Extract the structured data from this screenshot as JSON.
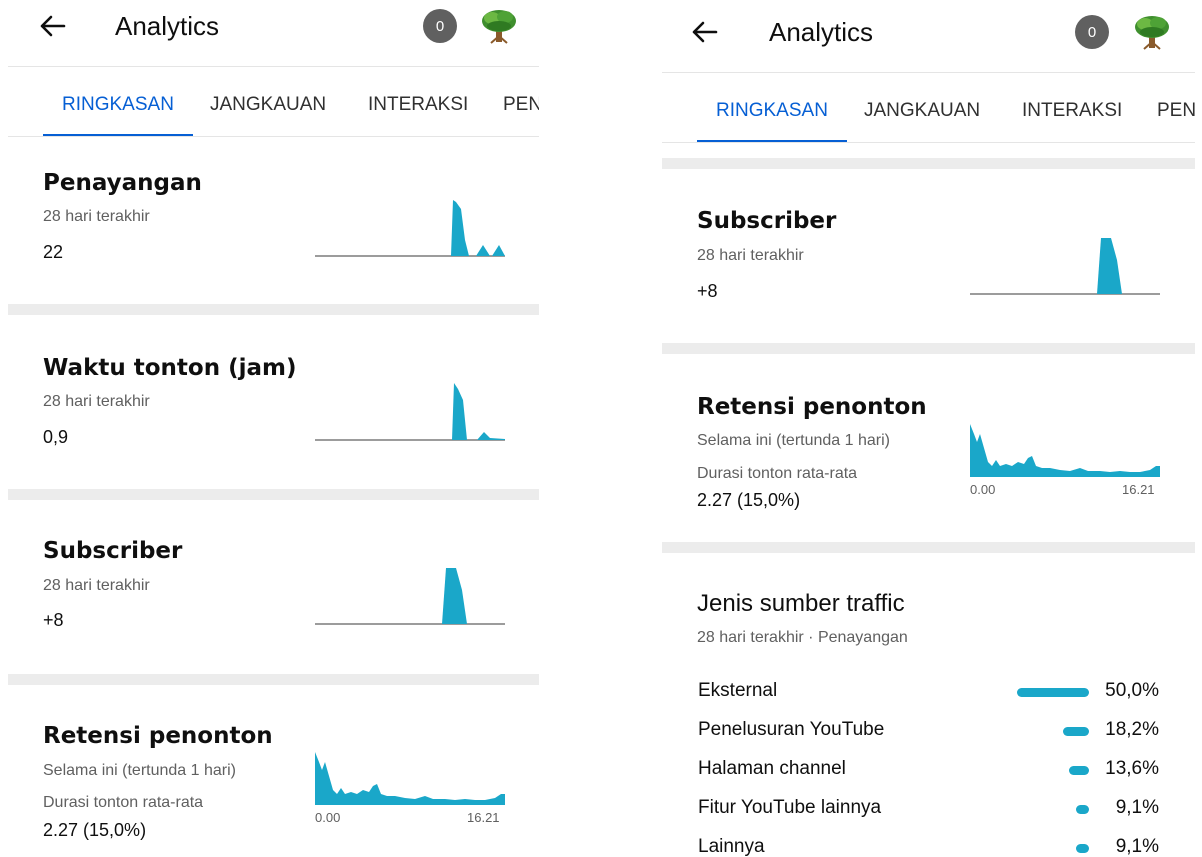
{
  "app": {
    "title": "Analytics",
    "notification_count": "0"
  },
  "tabs": [
    "RINGKASAN",
    "JANGKAUAN",
    "INTERAKSI",
    "PEN"
  ],
  "accent_color": "#065fd4",
  "chart_color": "#1aa7c9",
  "icons": {
    "back": "arrow-left-icon",
    "avatar": "tree-avatar-icon"
  },
  "cards": {
    "views": {
      "title": "Penayangan",
      "period": "28 hari terakhir",
      "value": "22"
    },
    "watch_time": {
      "title": "Waktu tonton (jam)",
      "period": "28 hari terakhir",
      "value": "0,9"
    },
    "subscribers": {
      "title": "Subscriber",
      "period": "28 hari terakhir",
      "value": "+8"
    },
    "retention": {
      "title": "Retensi penonton",
      "period": "Selama ini (tertunda 1 hari)",
      "avg_label": "Durasi tonton rata-rata",
      "value": "2.27 (15,0%)",
      "axis_start": "0.00",
      "axis_end": "16.21"
    }
  },
  "traffic": {
    "title": "Jenis sumber traffic",
    "subtitle": "28 hari terakhir · Penayangan",
    "sources": [
      {
        "label": "Eksternal",
        "pct": "50,0%",
        "share": 50.0
      },
      {
        "label": "Penelusuran YouTube",
        "pct": "18,2%",
        "share": 18.2
      },
      {
        "label": "Halaman channel",
        "pct": "13,6%",
        "share": 13.6
      },
      {
        "label": "Fitur YouTube lainnya",
        "pct": "9,1%",
        "share": 9.1
      },
      {
        "label": "Lainnya",
        "pct": "9,1%",
        "share": 9.1
      }
    ]
  }
}
